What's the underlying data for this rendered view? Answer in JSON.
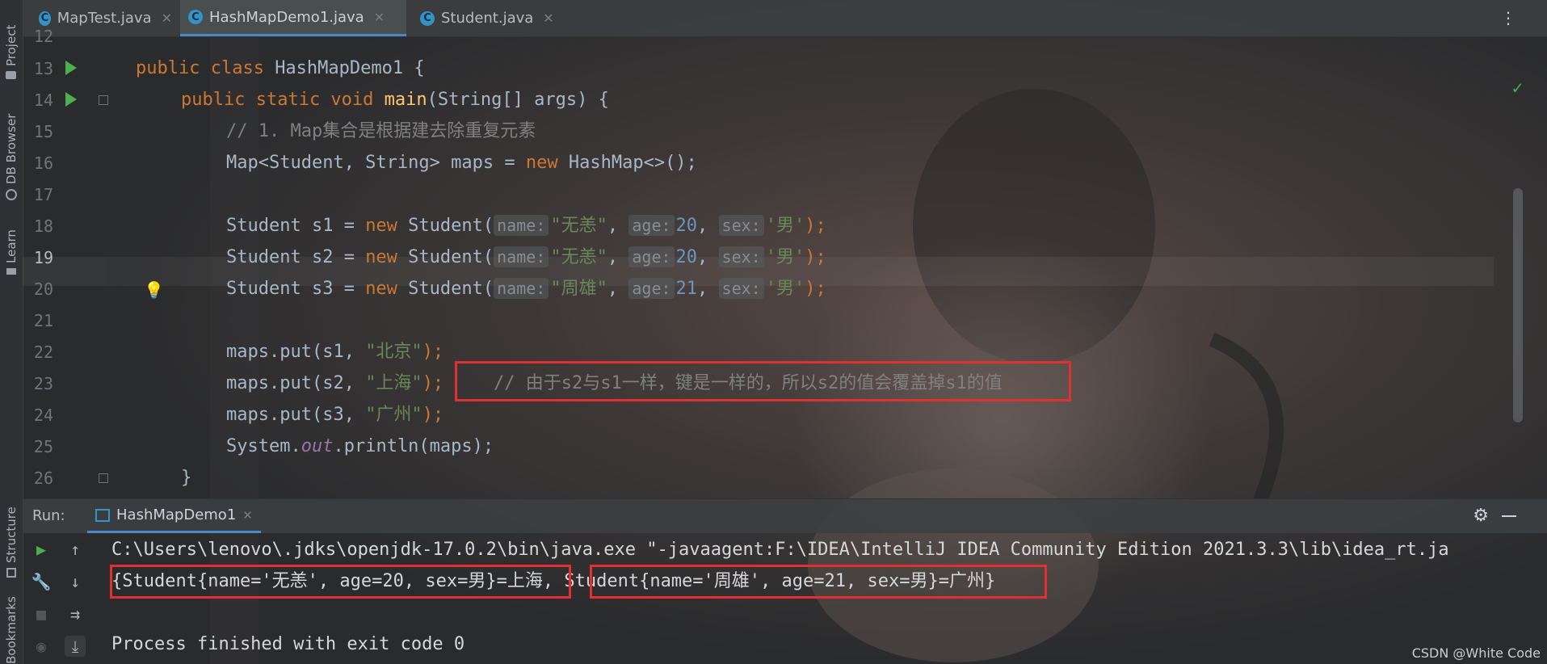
{
  "tabs": [
    {
      "label": "MapTest.java",
      "icon": "class-icon",
      "active": false
    },
    {
      "label": "HashMapDemo1.java",
      "icon": "class-icon",
      "active": true
    },
    {
      "label": "Student.java",
      "icon": "class-icon",
      "active": false
    }
  ],
  "side_tools": [
    "Project",
    "DB Browser",
    "Learn",
    "Structure",
    "Bookmarks"
  ],
  "line_numbers": [
    "12",
    "13",
    "14",
    "15",
    "16",
    "17",
    "18",
    "19",
    "20",
    "21",
    "22",
    "23",
    "24",
    "25",
    "26"
  ],
  "code": {
    "l13": {
      "a": "public class ",
      "b": "HashMapDemo1 {"
    },
    "l14": {
      "a": "public static void ",
      "b": "main",
      "c": "(String[] args) {"
    },
    "l15": "// 1. Map集合是根据建去除重复元素",
    "l16": {
      "a": "Map<Student, String> maps = ",
      "b": "new ",
      "c": "HashMap<>();"
    },
    "l18": {
      "a": "Student s1 = ",
      "b": "new ",
      "c": "Student(",
      "hn": "name:",
      "sv": "\"无恙\"",
      "ha": "age:",
      "av": "20",
      "hs": "sex:",
      "xv": "'男'",
      "end": ");"
    },
    "l19": {
      "a": "Student s2 = ",
      "b": "new ",
      "c": "Student(",
      "hn": "name:",
      "sv": "\"无恙\"",
      "ha": "age:",
      "av": "20",
      "hs": "sex:",
      "xv": "'男'",
      "end": ");"
    },
    "l20": {
      "a": "Student s3 = ",
      "b": "new ",
      "c": "Student(",
      "hn": "name:",
      "sv": "\"周雄\"",
      "ha": "age:",
      "av": "21",
      "hs": "sex:",
      "xv": "'男'",
      "end": ");"
    },
    "l22": {
      "a": "maps.put(s1, ",
      "s": "\"北京\"",
      "end": ");"
    },
    "l23": {
      "a": "maps.put(s2, ",
      "s": "\"上海\"",
      "end": ");",
      "comment": "// 由于s2与s1一样，键是一样的，所以s2的值会覆盖掉s1的值"
    },
    "l24": {
      "a": "maps.put(s3, ",
      "s": "\"广州\"",
      "end": ");"
    },
    "l25": {
      "a": "System.",
      "f": "out",
      "b": ".println(maps);"
    },
    "l26": "}"
  },
  "run": {
    "label": "Run:",
    "tab": "HashMapDemo1",
    "console": {
      "cmd": "C:\\Users\\lenovo\\.jdks\\openjdk-17.0.2\\bin\\java.exe \"-javaagent:F:\\IDEA\\IntelliJ IDEA Community Edition 2021.3.3\\lib\\idea_rt.ja",
      "out_open": "{",
      "out_a": "Student{name='无恙', age=20, sex=男}=上海",
      "out_sep": ", ",
      "out_b": "Student{name='周雄', age=21, sex=男}=广州",
      "out_close": "}",
      "exit": "Process finished with exit code 0"
    }
  },
  "watermark": "CSDN @White Code",
  "colors": {
    "keyword": "#cc7832",
    "string": "#6a8759",
    "number": "#6897bb",
    "comment": "#808080",
    "highlight_box": "#e03030"
  }
}
